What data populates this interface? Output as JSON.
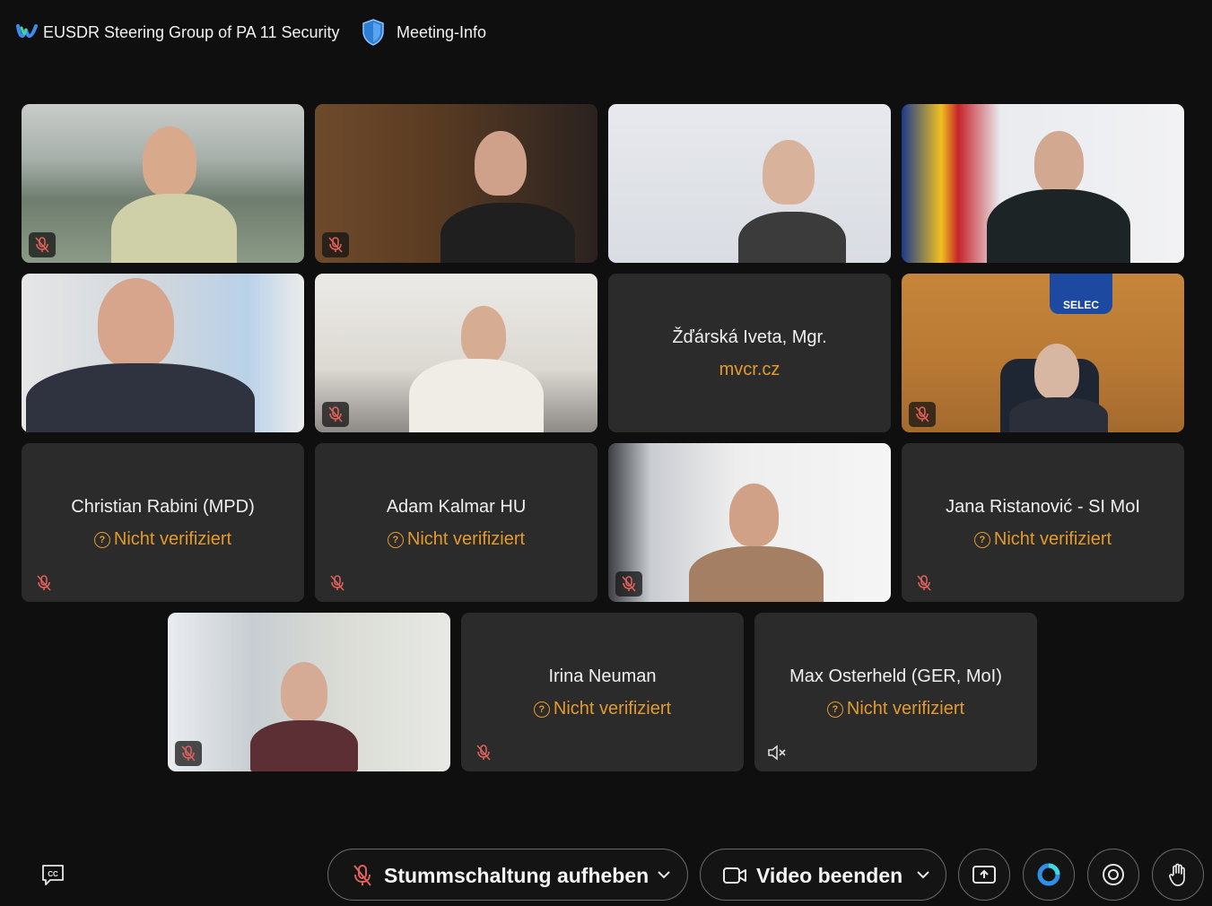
{
  "header": {
    "meeting_title": "EUSDR Steering Group of PA 11 Security",
    "meeting_info_label": "Meeting-Info"
  },
  "participants": [
    {
      "type": "video",
      "muted": true
    },
    {
      "type": "video",
      "muted": true
    },
    {
      "type": "video",
      "muted": false
    },
    {
      "type": "video",
      "muted": false
    },
    {
      "type": "video",
      "muted": false
    },
    {
      "type": "video",
      "muted": true
    },
    {
      "type": "name",
      "name": "Žďárská Iveta, Mgr.",
      "subtitle": "mvcr.cz"
    },
    {
      "type": "video",
      "muted": true,
      "logo_text": "SELEC"
    },
    {
      "type": "name",
      "name": "Christian Rabini (MPD)",
      "subtitle": "Nicht verifiziert",
      "muted": true
    },
    {
      "type": "name",
      "name": "Adam Kalmar HU",
      "subtitle": "Nicht verifiziert",
      "muted": true
    },
    {
      "type": "video",
      "muted": true
    },
    {
      "type": "name",
      "name": "Jana Ristanović - SI MoI",
      "subtitle": "Nicht verifiziert",
      "muted": true
    },
    {
      "type": "video",
      "muted": true
    },
    {
      "type": "name",
      "name": "Irina Neuman",
      "subtitle": "Nicht verifiziert",
      "muted": true
    },
    {
      "type": "name",
      "name": "Max Osterheld (GER, MoI)",
      "subtitle": "Nicht verifiziert",
      "speaker_muted": true
    }
  ],
  "toolbar": {
    "unmute_label": "Stummschaltung aufheben",
    "video_label": "Video beenden",
    "icons": [
      "closed-captions-icon",
      "mic-off-icon",
      "chevron-down-icon",
      "video-camera-icon",
      "share-icon",
      "webex-ai-icon",
      "record-icon",
      "raise-hand-icon"
    ]
  },
  "colors": {
    "background": "#0f0f0f",
    "tile": "#2b2b2b",
    "unverified": "#e39a2c",
    "mute_red": "#e0605a"
  }
}
